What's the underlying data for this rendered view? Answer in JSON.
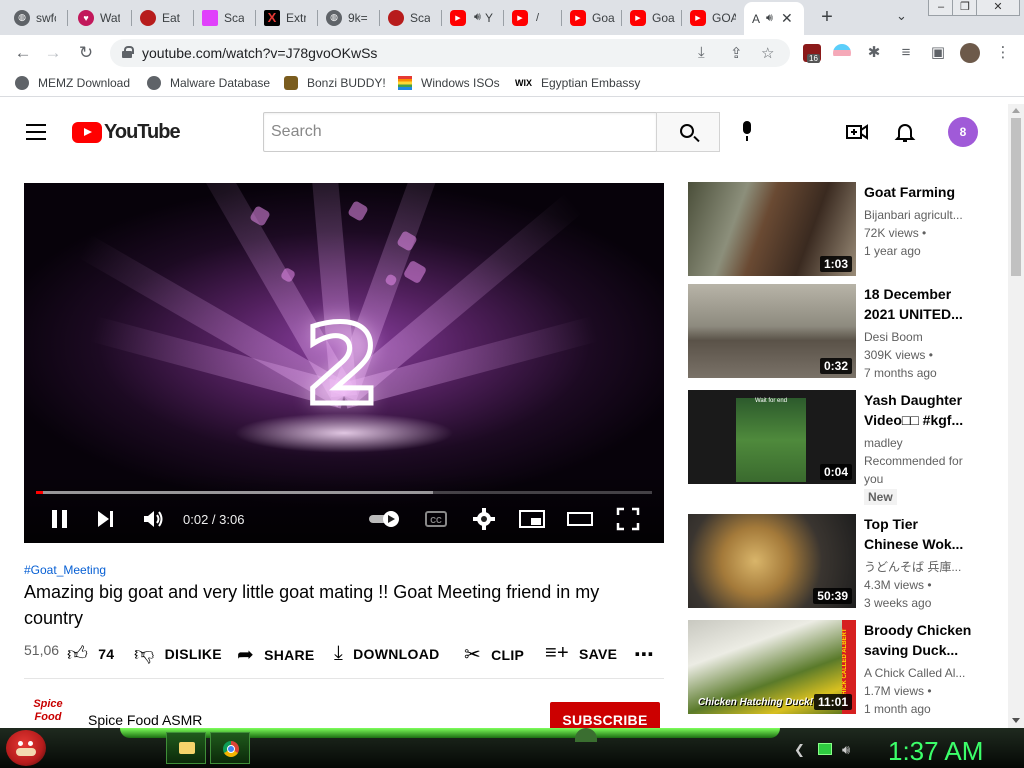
{
  "browser": {
    "tabs": [
      {
        "title": "swfc",
        "favicon": "globe-icon",
        "color": "#5f6368"
      },
      {
        "title": "Wat",
        "favicon": "heart-icon",
        "color": "#c2185b"
      },
      {
        "title": "Eat",
        "favicon": "red-dot-icon",
        "color": "#b71c1c"
      },
      {
        "title": "Scat",
        "favicon": "pink-square-icon",
        "color": "#e040fb"
      },
      {
        "title": "Extr",
        "favicon": "x-icon",
        "color": "#d32f2f"
      },
      {
        "title": "9k=",
        "favicon": "globe-icon",
        "color": "#5f6368"
      },
      {
        "title": "Scat",
        "favicon": "red-dot-icon",
        "color": "#b71c1c"
      },
      {
        "title": "Y",
        "favicon": "youtube-icon",
        "color": "#ff0000"
      },
      {
        "title": "",
        "favicon": "youtube-icon",
        "color": "#ff0000"
      },
      {
        "title": "Goa",
        "favicon": "youtube-icon",
        "color": "#ff0000"
      },
      {
        "title": "Goa",
        "favicon": "youtube-icon",
        "color": "#ff0000"
      },
      {
        "title": "GOA",
        "favicon": "youtube-icon",
        "color": "#ff0000"
      },
      {
        "title": "A",
        "favicon": "speaker-icon",
        "color": "#5f6368"
      }
    ],
    "url": "youtube.com/watch?v=J78gvoOKwSs",
    "extension_badge": "16",
    "bookmarks": [
      {
        "label": "MEMZ Download",
        "icon": "globe-icon"
      },
      {
        "label": "Malware Database",
        "icon": "globe-icon"
      },
      {
        "label": "Bonzi BUDDY!",
        "icon": "bonzi-icon"
      },
      {
        "label": "Windows ISOs",
        "icon": "windows-flag-icon"
      },
      {
        "label": "Egyptian Embassy",
        "icon": "wix-icon"
      }
    ],
    "wix_label": "WIX"
  },
  "youtube": {
    "logo_text": "YouTube",
    "search_placeholder": "Search",
    "avatar_letter": "8",
    "player": {
      "countdown": "2",
      "time": "0:02 / 3:06",
      "played_fraction": 0.011,
      "buffered_fraction": 0.645
    },
    "hashtag": "#Goat_Meeting",
    "title": "Amazing big goat and very little goat mating !! Goat Meeting friend in my country",
    "views": "51,06",
    "actions": {
      "like_count": "74",
      "dislike": "DISLIKE",
      "share": "SHARE",
      "download": "DOWNLOAD",
      "clip": "CLIP",
      "save": "SAVE"
    },
    "channel": {
      "logo_text": "Spice Food",
      "name": "Spice Food ASMR",
      "subscribe": "SUBSCRIBE"
    },
    "recommendations": [
      {
        "title": "Goat Farming",
        "channel": "Bijanbari agricult...",
        "views": "72K views •",
        "age": "1 year ago",
        "duration": "1:03"
      },
      {
        "title": "18 December 2021 UNITED...",
        "channel": "Desi Boom",
        "views": "309K views •",
        "age": "7 months ago",
        "duration": "0:32"
      },
      {
        "title": "Yash Daughter Video□□ #kgf...",
        "channel": "madley",
        "views": "Recommended for",
        "age": "you",
        "duration": "0:04",
        "badge": "New",
        "thumb_caption": "Wait for end"
      },
      {
        "title": "Top Tier Chinese Wok...",
        "channel": "うどんそば 兵庫...",
        "views": "4.3M views •",
        "age": "3 weeks ago",
        "duration": "50:39"
      },
      {
        "title": "Broody Chicken saving Duck...",
        "channel": "A Chick Called Al...",
        "views": "1.7M views •",
        "age": "1 month ago",
        "duration": "11:01",
        "thumb_caption": "Chicken Hatching Duck!",
        "thumb_side_text": "A CHICK CALLED ALBERT"
      }
    ]
  },
  "taskbar": {
    "clock": "1:37 AM"
  },
  "colors": {
    "youtube_red": "#ff0000",
    "subscribe_red": "#cc0000",
    "link_blue": "#065fd4",
    "clock_green": "#3cff6a"
  }
}
